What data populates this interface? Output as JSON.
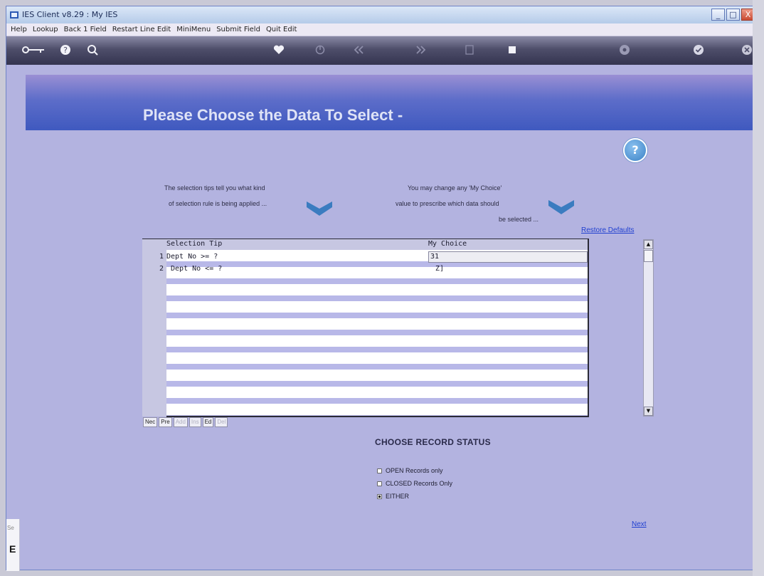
{
  "window": {
    "title": "IES Client v8.29 : My IES",
    "buttons": {
      "minimize": "_",
      "maximize": "□",
      "close": "X"
    }
  },
  "menu": [
    "Help",
    "Lookup",
    "Back 1 Field",
    "Restart Line Edit",
    "MiniMenu",
    "Submit Field",
    "Quit Edit"
  ],
  "toolbar": {
    "icons": [
      "key-icon",
      "help-icon",
      "search-icon",
      "heart-icon",
      "power-icon",
      "rewind-icon",
      "fast-forward-icon",
      "page-icon",
      "stop-icon",
      "settings-icon",
      "check-icon",
      "close-icon"
    ]
  },
  "banner": {
    "heading": "Please Choose the Data To Select -"
  },
  "tips": {
    "left_line1": "The selection tips tell you what kind",
    "left_line2": "of selection rule is being applied ...",
    "right_line1": "You may change any 'My Choice'",
    "right_line2": "value to prescribe which data should",
    "right_line3": "be selected ..."
  },
  "restore_defaults": "Restore Defaults",
  "grid": {
    "col_tip": "Selection Tip",
    "col_choice": "My Choice",
    "rows": [
      {
        "num": "1",
        "tip": "Dept No >= ?",
        "choice": "31"
      },
      {
        "num": "2",
        "tip": " Dept No <= ?",
        "choice": "Z]"
      }
    ]
  },
  "navbar": [
    "Nec",
    "Pre",
    "Add",
    "Ins",
    "Ed",
    "Del"
  ],
  "record_status": {
    "heading": "CHOOSE RECORD STATUS",
    "options": [
      "OPEN Records only",
      "CLOSED Records Only",
      "EITHER"
    ],
    "selected": "EITHER"
  },
  "next": "Next",
  "left_panel": {
    "label": "Se",
    "value": "E"
  },
  "colors": {
    "background": "#b3b3e0",
    "banner": "#3f59bf",
    "link": "#1f3fd0"
  }
}
